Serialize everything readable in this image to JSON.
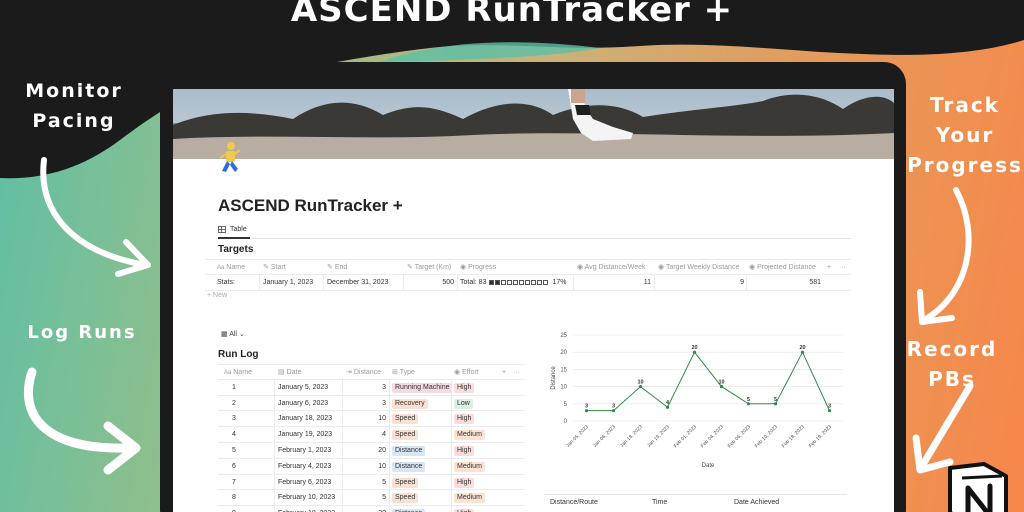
{
  "headline": "ASCEND RunTracker +",
  "side_labels": {
    "monitor": [
      "Monitor",
      "Pacing"
    ],
    "log": "Log Runs",
    "track": [
      "Track",
      "Your",
      "Progress"
    ],
    "record": [
      "Record",
      "PBs"
    ]
  },
  "colors": {
    "teal": "#5dbfa6",
    "orange": "#f7874a",
    "dark": "#1b1b1b",
    "chart_line": "#2e8b3f"
  },
  "page": {
    "title": "ASCEND RunTracker +",
    "view_tab": "Table",
    "view_icon": "table-icon",
    "runner_icon": "runner-emoji-icon"
  },
  "targets": {
    "title": "Targets",
    "columns": [
      "Name",
      "Start",
      "End",
      "Target (Km)",
      "Progress",
      "Avg Distance/Week",
      "Target Weekly Distance",
      "Projected Distance"
    ],
    "row": {
      "name": "Stats:",
      "start": "January 1, 2023",
      "end": "December 31, 2023",
      "target": "500",
      "progress_text": "Total: 83",
      "progress_fraction": 0.17,
      "progress_pct": "17%",
      "avg_week": "11",
      "target_weekly": "9",
      "projected": "581"
    },
    "new_label": "+ New",
    "add_symbol": "+",
    "more_symbol": "···"
  },
  "run_log": {
    "view_label": "All",
    "title": "Run Log",
    "columns": [
      "Name",
      "Date",
      "Distance",
      "Type",
      "Effort"
    ],
    "add_symbol": "+",
    "more_symbol": "···",
    "rows": [
      {
        "name": "1",
        "date": "January 5, 2023",
        "distance": "3",
        "type": "Running Machine",
        "effort": "High"
      },
      {
        "name": "2",
        "date": "January 6, 2023",
        "distance": "3",
        "type": "Recovery",
        "effort": "Low"
      },
      {
        "name": "3",
        "date": "January 18, 2023",
        "distance": "10",
        "type": "Speed",
        "effort": "High"
      },
      {
        "name": "4",
        "date": "January 19, 2023",
        "distance": "4",
        "type": "Speed",
        "effort": "Medium"
      },
      {
        "name": "5",
        "date": "February 1, 2023",
        "distance": "20",
        "type": "Distance",
        "effort": "High"
      },
      {
        "name": "6",
        "date": "February 4, 2023",
        "distance": "10",
        "type": "Distance",
        "effort": "Medium"
      },
      {
        "name": "7",
        "date": "February 6, 2023",
        "distance": "5",
        "type": "Speed",
        "effort": "High"
      },
      {
        "name": "8",
        "date": "February 10, 2023",
        "distance": "5",
        "type": "Speed",
        "effort": "Medium"
      },
      {
        "name": "9",
        "date": "February 18, 2023",
        "distance": "20",
        "type": "Distance",
        "effort": "High"
      }
    ],
    "type_colors": {
      "Running Machine": "#f5d9e4",
      "Recovery": "#fbe0d2",
      "Speed": "#fbe0d2",
      "Distance": "#d6e6f5"
    },
    "effort_colors": {
      "High": "#fbdcdc",
      "Low": "#dcefe0",
      "Medium": "#fbe3d3"
    }
  },
  "chart_data": {
    "type": "line",
    "x": [
      "Jan 05, 2023",
      "Jan 06, 2023",
      "Jan 18, 2023",
      "Jan 19, 2023",
      "Feb 01, 2023",
      "Feb 04, 2023",
      "Feb 06, 2023",
      "Feb 10, 2023",
      "Feb 18, 2023",
      "Feb 19, 2023"
    ],
    "series": [
      {
        "values": [
          3,
          3,
          10,
          4,
          20,
          10,
          5,
          5,
          20,
          3
        ]
      }
    ],
    "xlabel": "Date",
    "ylabel": "Distance",
    "ylim": [
      0,
      25
    ],
    "yticks": [
      0,
      5,
      10,
      15,
      20,
      25
    ],
    "grid": true,
    "data_labels": true
  },
  "pb_table": {
    "columns": [
      "Distance/Route",
      "Time",
      "Date Achieved"
    ]
  }
}
